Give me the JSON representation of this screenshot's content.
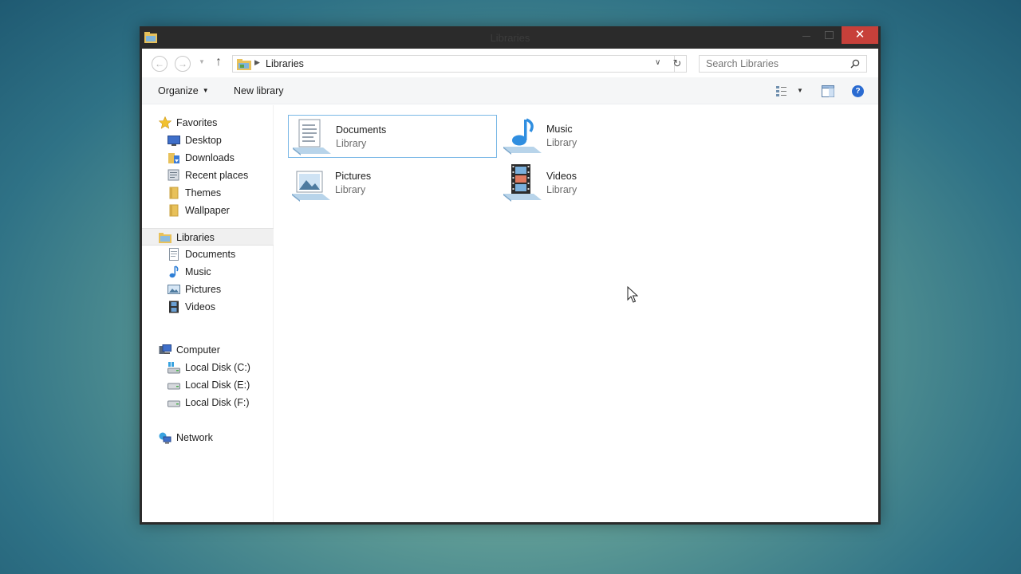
{
  "window": {
    "title": "Libraries",
    "close_glyph": "✕"
  },
  "navbar": {
    "back_glyph": "←",
    "forward_glyph": "→",
    "recent_glyph": "▼",
    "up_glyph": "↑",
    "address": "Libraries",
    "address_sep": "▶",
    "address_dd": "∨",
    "refresh_glyph": "↻",
    "search_placeholder": "Search Libraries"
  },
  "commandbar": {
    "organize_label": "Organize",
    "organize_caret": "▼",
    "new_library_label": "New library",
    "view_caret": "▼",
    "help_glyph": "?"
  },
  "sidebar": {
    "favorites": {
      "label": "Favorites",
      "items": [
        "Desktop",
        "Downloads",
        "Recent places",
        "Themes",
        "Wallpaper"
      ]
    },
    "libraries": {
      "label": "Libraries",
      "items": [
        "Documents",
        "Music",
        "Pictures",
        "Videos"
      ]
    },
    "computer": {
      "label": "Computer",
      "items": [
        "Local Disk (C:)",
        "Local Disk (E:)",
        "Local Disk (F:)"
      ]
    },
    "network": {
      "label": "Network"
    }
  },
  "content": {
    "tiles": [
      {
        "name": "Documents",
        "sub": "Library"
      },
      {
        "name": "Music",
        "sub": "Library"
      },
      {
        "name": "Pictures",
        "sub": "Library"
      },
      {
        "name": "Videos",
        "sub": "Library"
      }
    ]
  },
  "colors": {
    "close": "#c7403a",
    "selection_border": "#7ab8e6",
    "help": "#2a6bd1"
  }
}
